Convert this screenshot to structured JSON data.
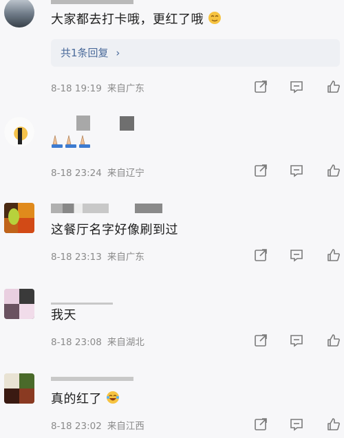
{
  "comments": [
    {
      "text": "大家都去打卡哦，更红了哦",
      "emoji": "smirk-emoji",
      "reply_summary": "共1条回复",
      "date": "8-18 19:19",
      "location": "来自广东"
    },
    {
      "text": "",
      "emoji": "praying-hands-emoji",
      "date": "8-18 23:24",
      "location": "来自辽宁"
    },
    {
      "text": "这餐厅名字好像刷到过",
      "date": "8-18 23:13",
      "location": "来自广东"
    },
    {
      "text": "我天",
      "date": "8-18 23:08",
      "location": "来自湖北"
    },
    {
      "text": "真的红了",
      "emoji": "laughing-tears-emoji",
      "date": "8-18 23:02",
      "location": "来自江西"
    }
  ],
  "icons": {
    "share": "share-icon",
    "comment": "comment-icon",
    "like": "thumbs-up-icon"
  },
  "colors": {
    "background": "#f7f7f9",
    "meta_text": "#8a8a8a",
    "reply_link": "#4a6a9a"
  }
}
